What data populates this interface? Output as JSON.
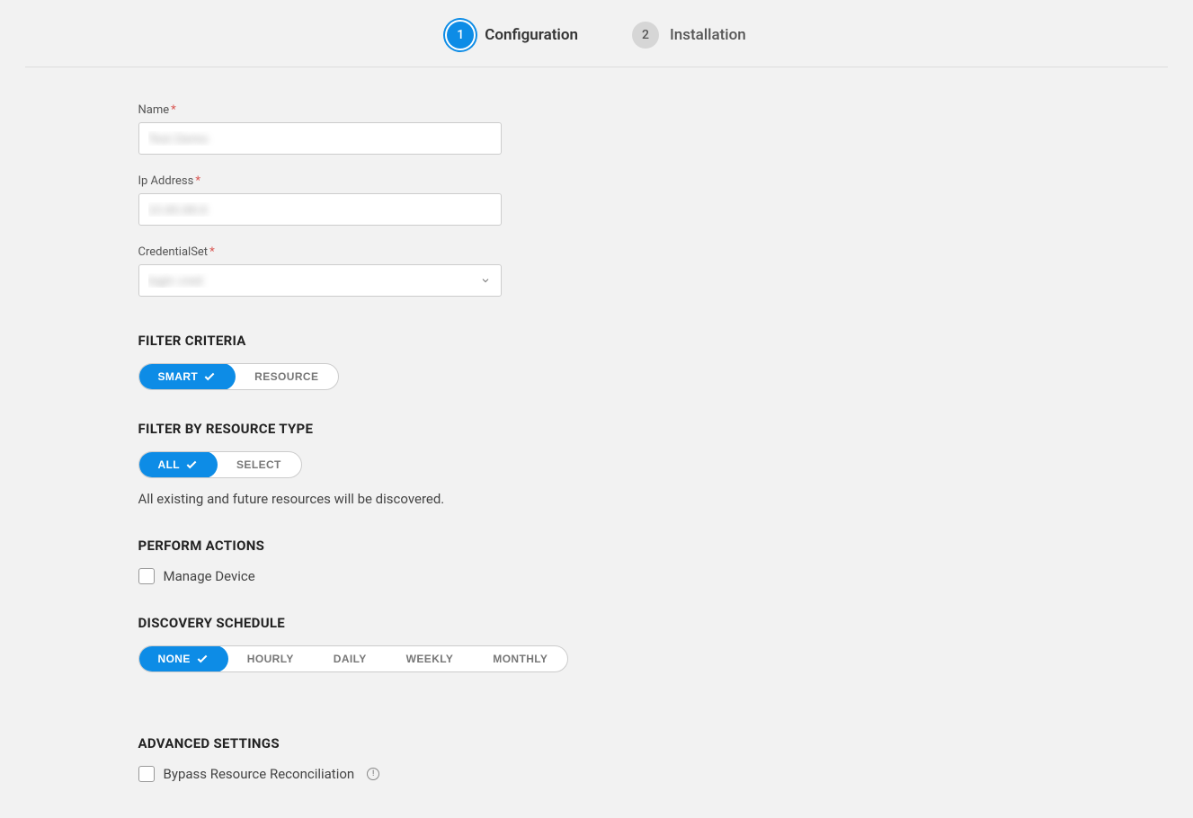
{
  "stepper": {
    "step1_num": "1",
    "step1_label": "Configuration",
    "step2_num": "2",
    "step2_label": "Installation"
  },
  "fields": {
    "name_label": "Name",
    "name_value": "Test Demo",
    "ip_label": "Ip Address",
    "ip_value": "10.60.68.6",
    "cred_label": "CredentialSet",
    "cred_value": "login cred"
  },
  "filter_criteria": {
    "title": "FILTER CRITERIA",
    "smart": "SMART",
    "resource": "RESOURCE"
  },
  "filter_resource_type": {
    "title": "FILTER BY RESOURCE TYPE",
    "all": "ALL",
    "select": "SELECT",
    "hint": "All existing and future resources will be discovered."
  },
  "perform_actions": {
    "title": "PERFORM ACTIONS",
    "manage_device": "Manage Device"
  },
  "discovery_schedule": {
    "title": "DISCOVERY SCHEDULE",
    "none": "NONE",
    "hourly": "HOURLY",
    "daily": "DAILY",
    "weekly": "WEEKLY",
    "monthly": "MONTHLY"
  },
  "advanced": {
    "title": "ADVANCED SETTINGS",
    "bypass": "Bypass Resource Reconciliation"
  }
}
